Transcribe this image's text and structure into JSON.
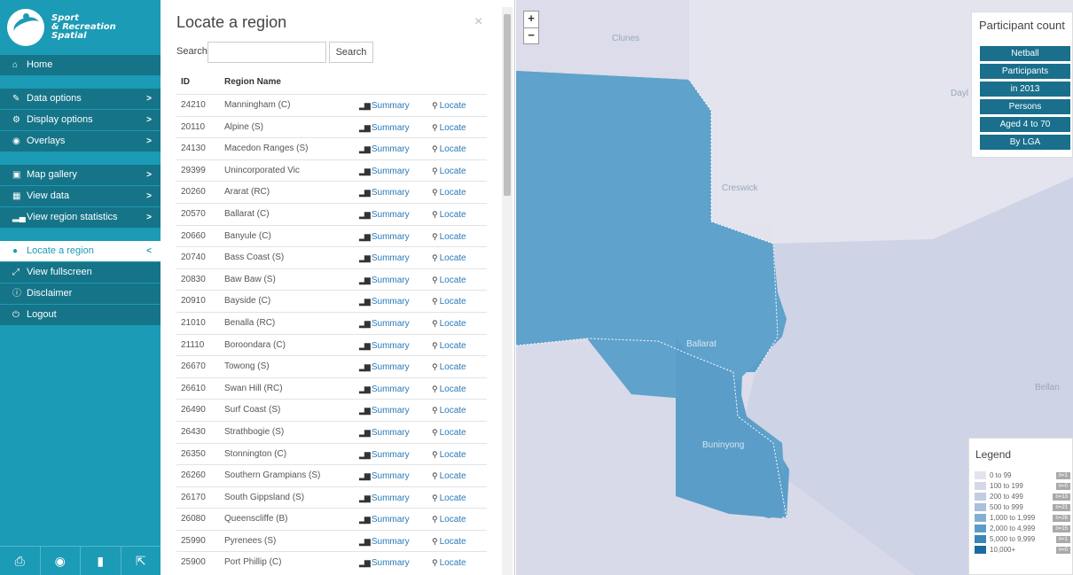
{
  "app": {
    "name_line1": "Sport",
    "name_line2": "& Recreation",
    "name_line3": "Spatial"
  },
  "sidebar": {
    "home": {
      "label": "Home",
      "icon": "home-icon"
    },
    "group1": [
      {
        "label": "Data options",
        "icon": "pencil-icon",
        "chevron": ">"
      },
      {
        "label": "Display options",
        "icon": "gear-icon",
        "chevron": ">"
      },
      {
        "label": "Overlays",
        "icon": "eye-icon",
        "chevron": ">"
      }
    ],
    "group2": [
      {
        "label": "Map gallery",
        "icon": "image-icon",
        "chevron": ">"
      },
      {
        "label": "View data",
        "icon": "table-icon",
        "chevron": ">"
      },
      {
        "label": "View region statistics",
        "icon": "bar-chart-icon",
        "chevron": ">"
      }
    ],
    "group3": [
      {
        "label": "Locate a region",
        "icon": "globe-icon",
        "chevron": "<",
        "active": true
      },
      {
        "label": "View fullscreen",
        "icon": "expand-icon",
        "chevron": ""
      },
      {
        "label": "Disclaimer",
        "icon": "info-icon",
        "chevron": ""
      },
      {
        "label": "Logout",
        "icon": "power-icon",
        "chevron": ""
      }
    ],
    "footer_icons": [
      "print-icon",
      "camera-icon",
      "bookmark-icon",
      "export-icon"
    ]
  },
  "panel": {
    "title": "Locate a region",
    "close": "×",
    "search_label": "Search",
    "search_value": "",
    "search_button": "Search",
    "columns": {
      "id": "ID",
      "name": "Region Name"
    },
    "summary_label": "Summary",
    "locate_label": "Locate",
    "rows": [
      {
        "id": "24210",
        "name": "Manningham (C)"
      },
      {
        "id": "20110",
        "name": "Alpine (S)"
      },
      {
        "id": "24130",
        "name": "Macedon Ranges (S)"
      },
      {
        "id": "29399",
        "name": "Unincorporated Vic"
      },
      {
        "id": "20260",
        "name": "Ararat (RC)"
      },
      {
        "id": "20570",
        "name": "Ballarat (C)"
      },
      {
        "id": "20660",
        "name": "Banyule (C)"
      },
      {
        "id": "20740",
        "name": "Bass Coast (S)"
      },
      {
        "id": "20830",
        "name": "Baw Baw (S)"
      },
      {
        "id": "20910",
        "name": "Bayside (C)"
      },
      {
        "id": "21010",
        "name": "Benalla (RC)"
      },
      {
        "id": "21110",
        "name": "Boroondara (C)"
      },
      {
        "id": "26670",
        "name": "Towong (S)"
      },
      {
        "id": "26610",
        "name": "Swan Hill (RC)"
      },
      {
        "id": "26490",
        "name": "Surf Coast (S)"
      },
      {
        "id": "26430",
        "name": "Strathbogie (S)"
      },
      {
        "id": "26350",
        "name": "Stonnington (C)"
      },
      {
        "id": "26260",
        "name": "Southern Grampians (S)"
      },
      {
        "id": "26170",
        "name": "South Gippsland (S)"
      },
      {
        "id": "26080",
        "name": "Queenscliffe (B)"
      },
      {
        "id": "25990",
        "name": "Pyrenees (S)"
      },
      {
        "id": "25900",
        "name": "Port Phillip (C)"
      }
    ]
  },
  "map": {
    "zoom_in": "+",
    "zoom_out": "−",
    "labels": {
      "clunes": "Clunes",
      "creswick": "Creswick",
      "ballarat": "Ballarat",
      "buninyong": "Buninyong",
      "bellan": "Bellan",
      "daylesford": "Dayl"
    },
    "participant_count": {
      "title": "Participant count",
      "chips": [
        "Netball",
        "Participants",
        "in 2013",
        "Persons",
        "Aged 4 to 70",
        "By LGA"
      ]
    },
    "legend": {
      "title": "Legend",
      "items": [
        {
          "label": "0 to 99",
          "count": "n=1",
          "color": "#e4e4ef"
        },
        {
          "label": "100 to 199",
          "count": "n=0",
          "color": "#d6d8e8"
        },
        {
          "label": "200 to 499",
          "count": "n=13",
          "color": "#c4cce2"
        },
        {
          "label": "500 to 999",
          "count": "n=21",
          "color": "#a9bfdb"
        },
        {
          "label": "1,000 to 1,999",
          "count": "n=26",
          "color": "#86aed3"
        },
        {
          "label": "2,000 to 4,999",
          "count": "n=15",
          "color": "#5a9dc8"
        },
        {
          "label": "5,000 to 9,999",
          "count": "n=1",
          "color": "#3a86b8"
        },
        {
          "label": "10,000+",
          "count": "n=0",
          "color": "#1d6aa0"
        }
      ]
    }
  }
}
